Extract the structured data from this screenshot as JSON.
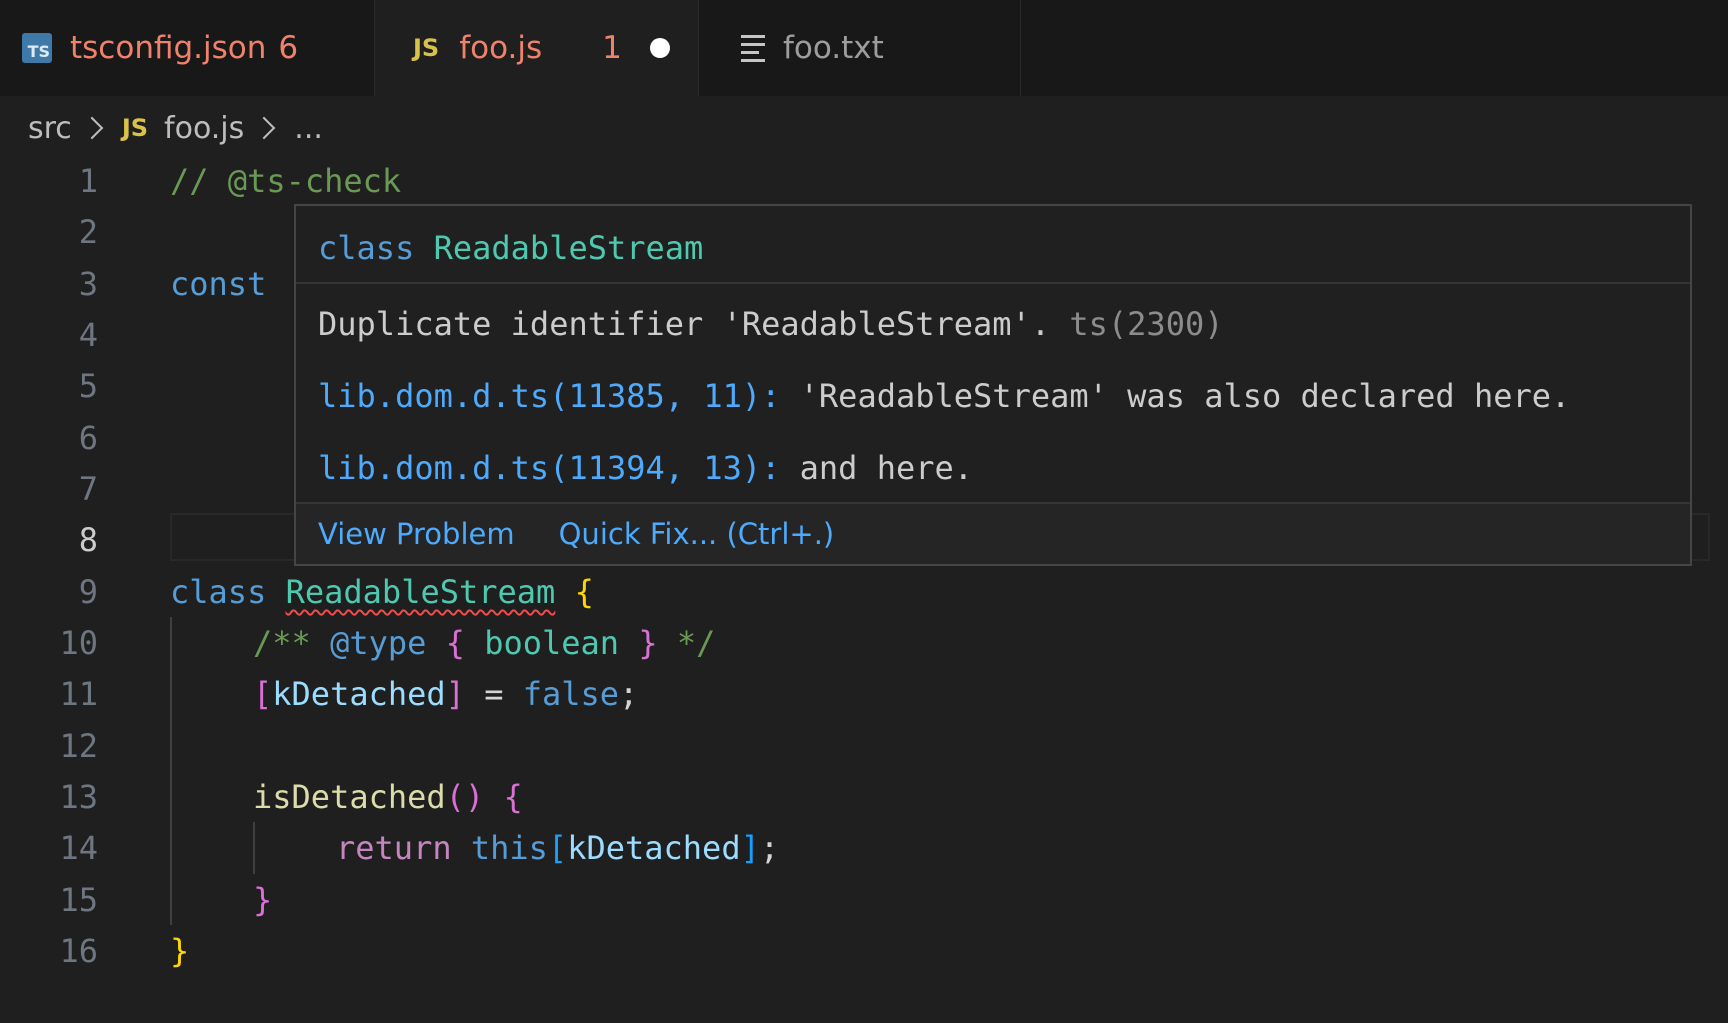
{
  "tabs": [
    {
      "label": "tsconfig.json",
      "count": "6",
      "icon": "ts-file-icon",
      "icon_text": "TS"
    },
    {
      "label": "foo.js",
      "count": "1",
      "icon": "js-file-icon",
      "icon_text": "JS",
      "dirty": true
    },
    {
      "label": "foo.txt",
      "icon": "text-file-icon"
    }
  ],
  "breadcrumb": {
    "folder": "src",
    "file_icon_text": "JS",
    "file": "foo.js",
    "more": "..."
  },
  "editor": {
    "line_numbers": [
      "1",
      "2",
      "3",
      "4",
      "5",
      "6",
      "7",
      "8",
      "9",
      "10",
      "11",
      "12",
      "13",
      "14",
      "15",
      "16"
    ],
    "current_line": "8",
    "lines": {
      "l1": {
        "comment": "// @ts-check"
      },
      "l3": {
        "kw": "const"
      },
      "l9": {
        "kw": "class",
        "name": "ReadableStream",
        "brace": "{"
      },
      "l10": {
        "open": "/**",
        "tag": "@type",
        "lb": "{",
        "type": "boolean",
        "rb": "}",
        "close": "*/"
      },
      "l11": {
        "lb": "[",
        "prop": "kDetached",
        "rb": "]",
        "eq": " = ",
        "val": "false",
        "semi": ";"
      },
      "l13": {
        "fn": "isDetached",
        "parens": "()",
        "brace": "{"
      },
      "l14": {
        "kw": "return",
        "self": "this",
        "lb": "[",
        "prop": "kDetached",
        "rb": "]",
        "semi": ";"
      },
      "l15": {
        "brace": "}"
      },
      "l16": {
        "brace": "}"
      }
    }
  },
  "hover": {
    "sig_kw": "class",
    "sig_name": "ReadableStream",
    "message": "Duplicate identifier 'ReadableStream'.",
    "code": "ts(2300)",
    "related": [
      {
        "link": "lib.dom.d.ts(11385, 11):",
        "text": " 'ReadableStream' was also declared here."
      },
      {
        "link": "lib.dom.d.ts(11394, 13):",
        "text": " and here."
      }
    ],
    "actions": {
      "view_problem": "View Problem",
      "quick_fix": "Quick Fix... (Ctrl+.)"
    }
  },
  "colors": {
    "editor_bg": "#1f1f1f",
    "error": "#f14c4c",
    "link": "#4daafc"
  }
}
